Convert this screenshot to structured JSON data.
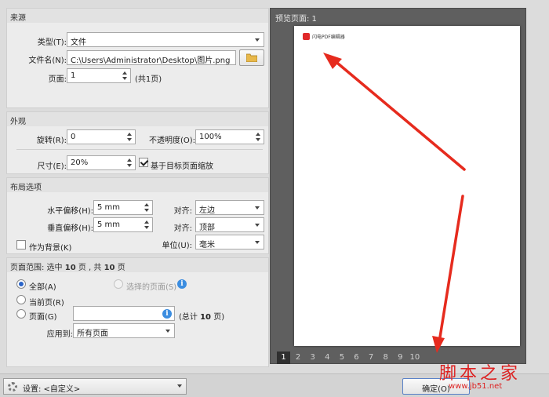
{
  "source": {
    "title": "来源",
    "type_label": "类型(T):",
    "type_value": "文件",
    "filename_label": "文件名(N):",
    "filename_value": "C:\\Users\\Administrator\\Desktop\\图片.png",
    "page_label": "页面:",
    "page_value": "1",
    "page_total": "(共1页)"
  },
  "appearance": {
    "title": "外观",
    "rotation_label": "旋转(R):",
    "rotation_value": "0",
    "opacity_label": "不透明度(O):",
    "opacity_value": "100%",
    "size_label": "尺寸(E):",
    "size_value": "20%",
    "scale_checkbox_label": "基于目标页面缩放",
    "scale_checked": true
  },
  "layout": {
    "title": "布局选项",
    "h_offset_label": "水平偏移(H):",
    "h_offset_value": "5 mm",
    "h_align_label": "对齐:",
    "h_align_value": "左边",
    "v_offset_label": "垂直偏移(H):",
    "v_offset_value": "5 mm",
    "v_align_label": "对齐:",
    "v_align_value": "顶部",
    "background_label": "作为背景(K)",
    "background_checked": false,
    "unit_label": "单位(U):",
    "unit_value": "毫米"
  },
  "page_range": {
    "title_prefix": "页面范围: 选中",
    "selected_count": "10",
    "title_mid": "页 , 共",
    "total_count": "10",
    "title_suffix": "页",
    "all_label": "全部(A)",
    "selected_pages_label": "选择的页面(S)",
    "current_label": "当前页(R)",
    "pages_label": "页面(G)",
    "pages_total_prefix": "(总计",
    "pages_total_count": "10",
    "pages_total_suffix": "页)",
    "apply_to_label": "应用到:",
    "apply_to_value": "所有页面"
  },
  "preview": {
    "title": "预览页面: 1",
    "logo_text": "闪电PDF编辑器",
    "pages": [
      "1",
      "2",
      "3",
      "4",
      "5",
      "6",
      "7",
      "8",
      "9",
      "10"
    ],
    "active_page": "1"
  },
  "bottom": {
    "settings_label": "设置: <自定义>",
    "ok_label": "确定(O)"
  },
  "watermark": {
    "text": "脚本之家",
    "url": "www.jb51.net"
  },
  "colors": {
    "arrow": "#e62b1e",
    "accent": "#2a64c8"
  }
}
